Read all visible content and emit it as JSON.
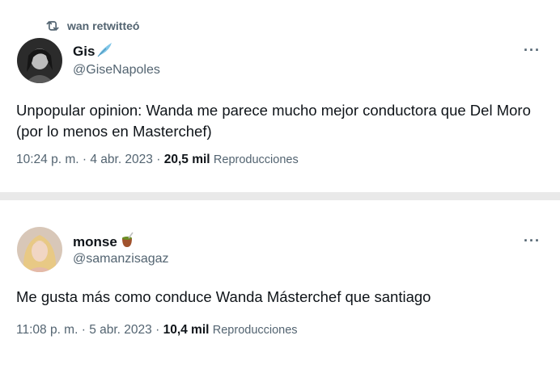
{
  "tweets": [
    {
      "retweet_by": "wan retwitteó",
      "display_name": "Gis",
      "name_emoji": "🪶",
      "handle": "@GiseNapoles",
      "more": "···",
      "text": "Unpopular opinion: Wanda me parece mucho mejor conductora que Del Moro (por lo menos en Masterchef)",
      "time": "10:24 p. m.",
      "sep1": "·",
      "date": "4 abr. 2023",
      "sep2": "·",
      "views_count": "20,5 mil",
      "views_label": "Reproducciones",
      "retweet_icon": "retweet-icon"
    },
    {
      "display_name": "monse",
      "name_emoji": "🧉",
      "handle": "@samanzisagaz",
      "more": "···",
      "text": "Me gusta más como conduce Wanda Másterchef que santiago",
      "time": "11:08 p. m.",
      "sep1": "·",
      "date": "5 abr. 2023",
      "sep2": "·",
      "views_count": "10,4 mil",
      "views_label": "Reproducciones"
    }
  ],
  "colors": {
    "primary_text": "#0f1419",
    "secondary_text": "#536471",
    "background": "#ffffff",
    "gap": "#e9e9e9"
  }
}
